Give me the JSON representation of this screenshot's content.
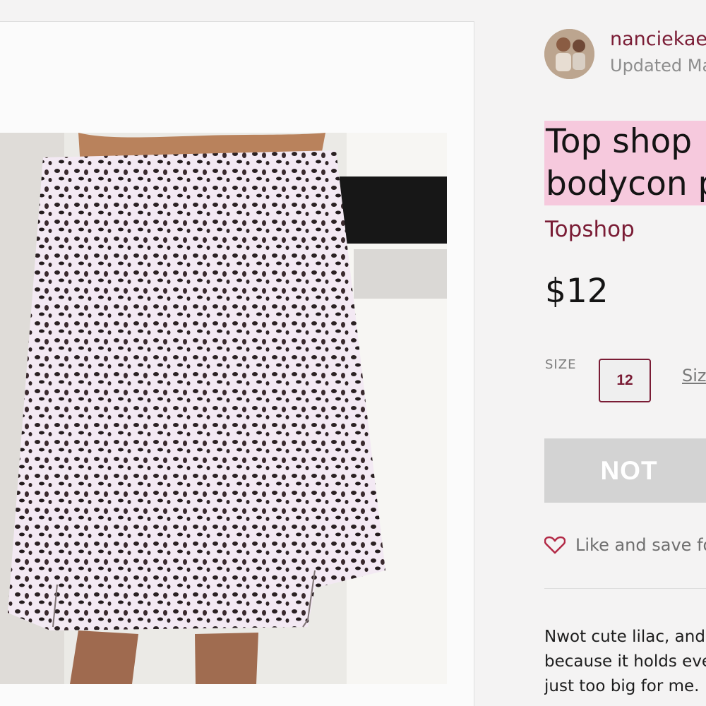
{
  "seller": {
    "name": "nanciekae",
    "updated": "Updated Ma"
  },
  "listing": {
    "title_line1": "Top shop",
    "title_line2": "bodycon p",
    "brand": "Topshop",
    "price": "$12",
    "size_label": "SIZE",
    "size_value": "12",
    "size_guide": "Siz",
    "cta": "NOT",
    "like_text": "Like and save fo",
    "description_lines": [
      "Nwot cute lilac, and",
      "because it holds eve",
      "just too big for me."
    ]
  },
  "colors": {
    "accent": "#7a1c35",
    "highlight": "#f6c9dd",
    "disabled_button": "#d3d3d3",
    "brand_red": "#e2183b"
  },
  "icons": {
    "like": "heart-outline-icon"
  }
}
